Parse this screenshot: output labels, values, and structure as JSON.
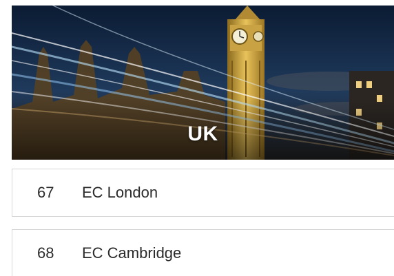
{
  "hero": {
    "title": "UK",
    "image_subject": "big-ben-night-light-trails"
  },
  "locations": [
    {
      "number": "67",
      "name": "EC London"
    },
    {
      "number": "68",
      "name": "EC Cambridge"
    }
  ],
  "colors": {
    "text": "#2b2b2b",
    "border": "#d6d6d6",
    "hero_overlay_text": "#ffffff"
  }
}
